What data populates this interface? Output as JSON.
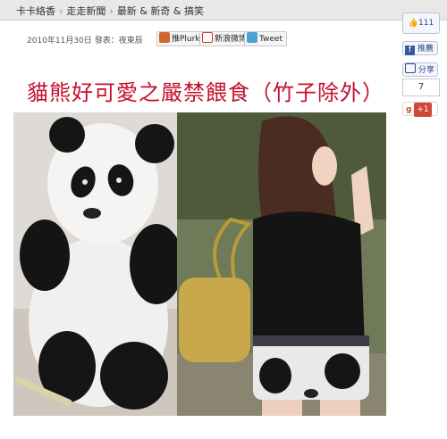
{
  "breadcrumb": [
    "卡卡絡香",
    "走走新聞",
    "最新 & 新奇 & 搞笑"
  ],
  "post": {
    "date": "2010年11月30日",
    "author_label": "發表：",
    "author": "夜東辰",
    "title": "貓熊好可愛之嚴禁餵食（竹子除外）"
  },
  "share": {
    "plurk": "推Plurk",
    "sina": "新浪微博",
    "tweet": "Tweet"
  },
  "sidebar": {
    "like_count": "111",
    "facebook_label": "推薦",
    "share_label": "分享",
    "share_count": "7",
    "gplus_label": "+1"
  },
  "colors": {
    "title": "#c4102c",
    "facebook": "#3b5998",
    "twitter": "#4aa1d8",
    "plurk": "#cf682f",
    "gplus": "#d14836"
  }
}
